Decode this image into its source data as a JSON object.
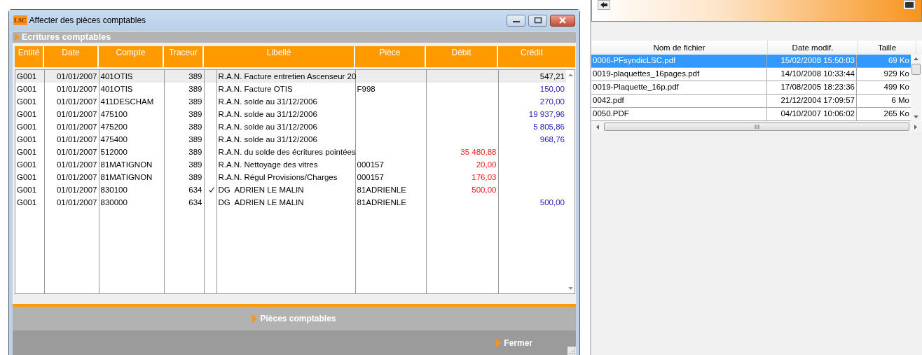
{
  "dialog": {
    "title": "Affecter des pièces comptables",
    "logo": "LSC",
    "section": "Ecritures comptables",
    "columns": [
      "Entité",
      "Date",
      "Compte",
      "Traceur",
      "Libellé",
      "Pièce",
      "Débit",
      "Crédit"
    ],
    "rows": [
      {
        "entity": "G001",
        "date": "01/01/2007",
        "account": "401OTIS",
        "tracer": "389",
        "checked": false,
        "label": "R.A.N. Facture entretien Ascenseur 20",
        "piece": "",
        "debit": "",
        "credit": "547,21",
        "selected": true
      },
      {
        "entity": "G001",
        "date": "01/01/2007",
        "account": "401OTIS",
        "tracer": "389",
        "checked": false,
        "label": "R.A.N. Facture OTIS",
        "piece": "F998",
        "debit": "",
        "credit": "150,00",
        "selected": false
      },
      {
        "entity": "G001",
        "date": "01/01/2007",
        "account": "411DESCHAM",
        "tracer": "389",
        "checked": false,
        "label": "R.A.N. solde au 31/12/2006",
        "piece": "",
        "debit": "",
        "credit": "270,00",
        "selected": false
      },
      {
        "entity": "G001",
        "date": "01/01/2007",
        "account": "475100",
        "tracer": "389",
        "checked": false,
        "label": "R.A.N. solde au 31/12/2006",
        "piece": "",
        "debit": "",
        "credit": "19 937,96",
        "selected": false
      },
      {
        "entity": "G001",
        "date": "01/01/2007",
        "account": "475200",
        "tracer": "389",
        "checked": false,
        "label": "R.A.N. solde au 31/12/2006",
        "piece": "",
        "debit": "",
        "credit": "5 805,86",
        "selected": false
      },
      {
        "entity": "G001",
        "date": "01/01/2007",
        "account": "475400",
        "tracer": "389",
        "checked": false,
        "label": "R.A.N. solde au 31/12/2006",
        "piece": "",
        "debit": "",
        "credit": "968,76",
        "selected": false
      },
      {
        "entity": "G001",
        "date": "01/01/2007",
        "account": "512000",
        "tracer": "389",
        "checked": false,
        "label": "R.A.N. du solde des écritures pointées",
        "piece": "",
        "debit": "35 480,88",
        "credit": "",
        "selected": false
      },
      {
        "entity": "G001",
        "date": "01/01/2007",
        "account": "81MATIGNON",
        "tracer": "389",
        "checked": false,
        "label": "R.A.N. Nettoyage des vitres",
        "piece": "000157",
        "debit": "20,00",
        "credit": "",
        "selected": false
      },
      {
        "entity": "G001",
        "date": "01/01/2007",
        "account": "81MATIGNON",
        "tracer": "389",
        "checked": false,
        "label": "R.A.N. Régul Provisions/Charges",
        "piece": "000157",
        "debit": "176,03",
        "credit": "",
        "selected": false
      },
      {
        "entity": "G001",
        "date": "01/01/2007",
        "account": "830100",
        "tracer": "634",
        "checked": true,
        "label": "DG  ADRIEN LE MALIN",
        "piece": "81ADRIENLE",
        "debit": "500,00",
        "credit": "",
        "selected": false
      },
      {
        "entity": "G001",
        "date": "01/01/2007",
        "account": "830000",
        "tracer": "634",
        "checked": false,
        "label": "DG  ADRIEN LE MALIN",
        "piece": "81ADRIENLE",
        "debit": "",
        "credit": "500,00",
        "selected": false
      }
    ],
    "buttons": [
      "Pièces comptables",
      "Fermer"
    ]
  },
  "file_list": {
    "columns": [
      "Nom de fichier",
      "Date modif.",
      "Taille"
    ],
    "files": [
      {
        "name": "0006-PFsyndicLSC.pdf",
        "modified": "15/02/2008 15:50:03",
        "size": "69 Ko",
        "selected": true
      },
      {
        "name": "0019-plaquettes_16pages.pdf",
        "modified": "14/10/2008 10:33:44",
        "size": "929 Ko",
        "selected": false
      },
      {
        "name": "0019-Plaquette_16p.pdf",
        "modified": "17/08/2005 18:23:36",
        "size": "499 Ko",
        "selected": false
      },
      {
        "name": "0042.pdf",
        "modified": "21/12/2004 17:09:57",
        "size": "6 Mo",
        "selected": false
      },
      {
        "name": "0050.PDF",
        "modified": "04/10/2007 10:06:02",
        "size": "265 Ko",
        "selected": false
      }
    ]
  }
}
